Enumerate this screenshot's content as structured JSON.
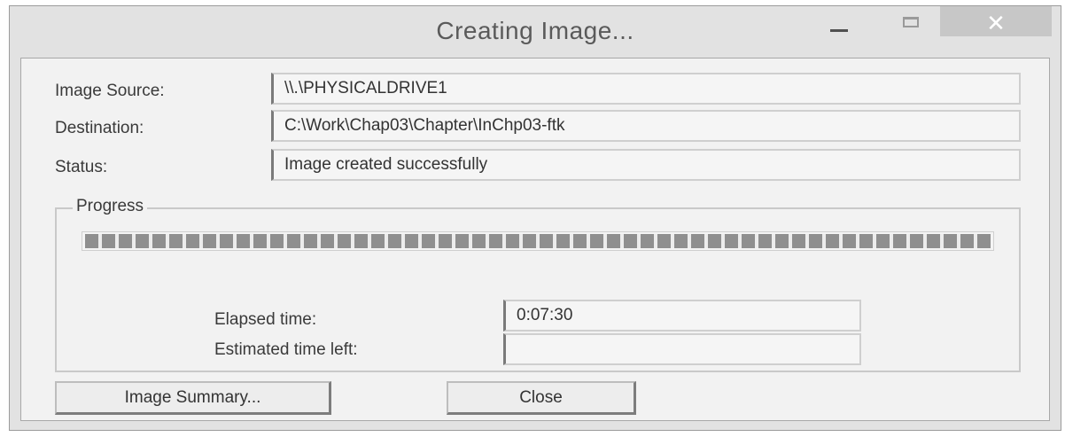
{
  "window": {
    "title": "Creating Image...",
    "minimize_icon": "minimize-icon",
    "maximize_icon": "maximize-icon",
    "close_icon": "close-x-icon",
    "close_glyph": "✕"
  },
  "fields": {
    "image_source": {
      "label": "Image Source:",
      "value": "\\\\.\\PHYSICALDRIVE1"
    },
    "destination": {
      "label": "Destination:",
      "value": "C:\\Work\\Chap03\\Chapter\\InChp03-ftk"
    },
    "status": {
      "label": "Status:",
      "value": "Image created successfully"
    }
  },
  "progress": {
    "group_label": "Progress",
    "percent": 100,
    "elapsed": {
      "label": "Elapsed time:",
      "value": "0:07:30"
    },
    "estimated": {
      "label": "Estimated time left:",
      "value": ""
    }
  },
  "buttons": {
    "image_summary": "Image Summary...",
    "close": "Close"
  },
  "colors": {
    "window_bg": "#e2e2e2",
    "client_bg": "#f2f2f2",
    "progress_block": "#8f8f8f",
    "close_button_bg": "#c7c7c7"
  }
}
